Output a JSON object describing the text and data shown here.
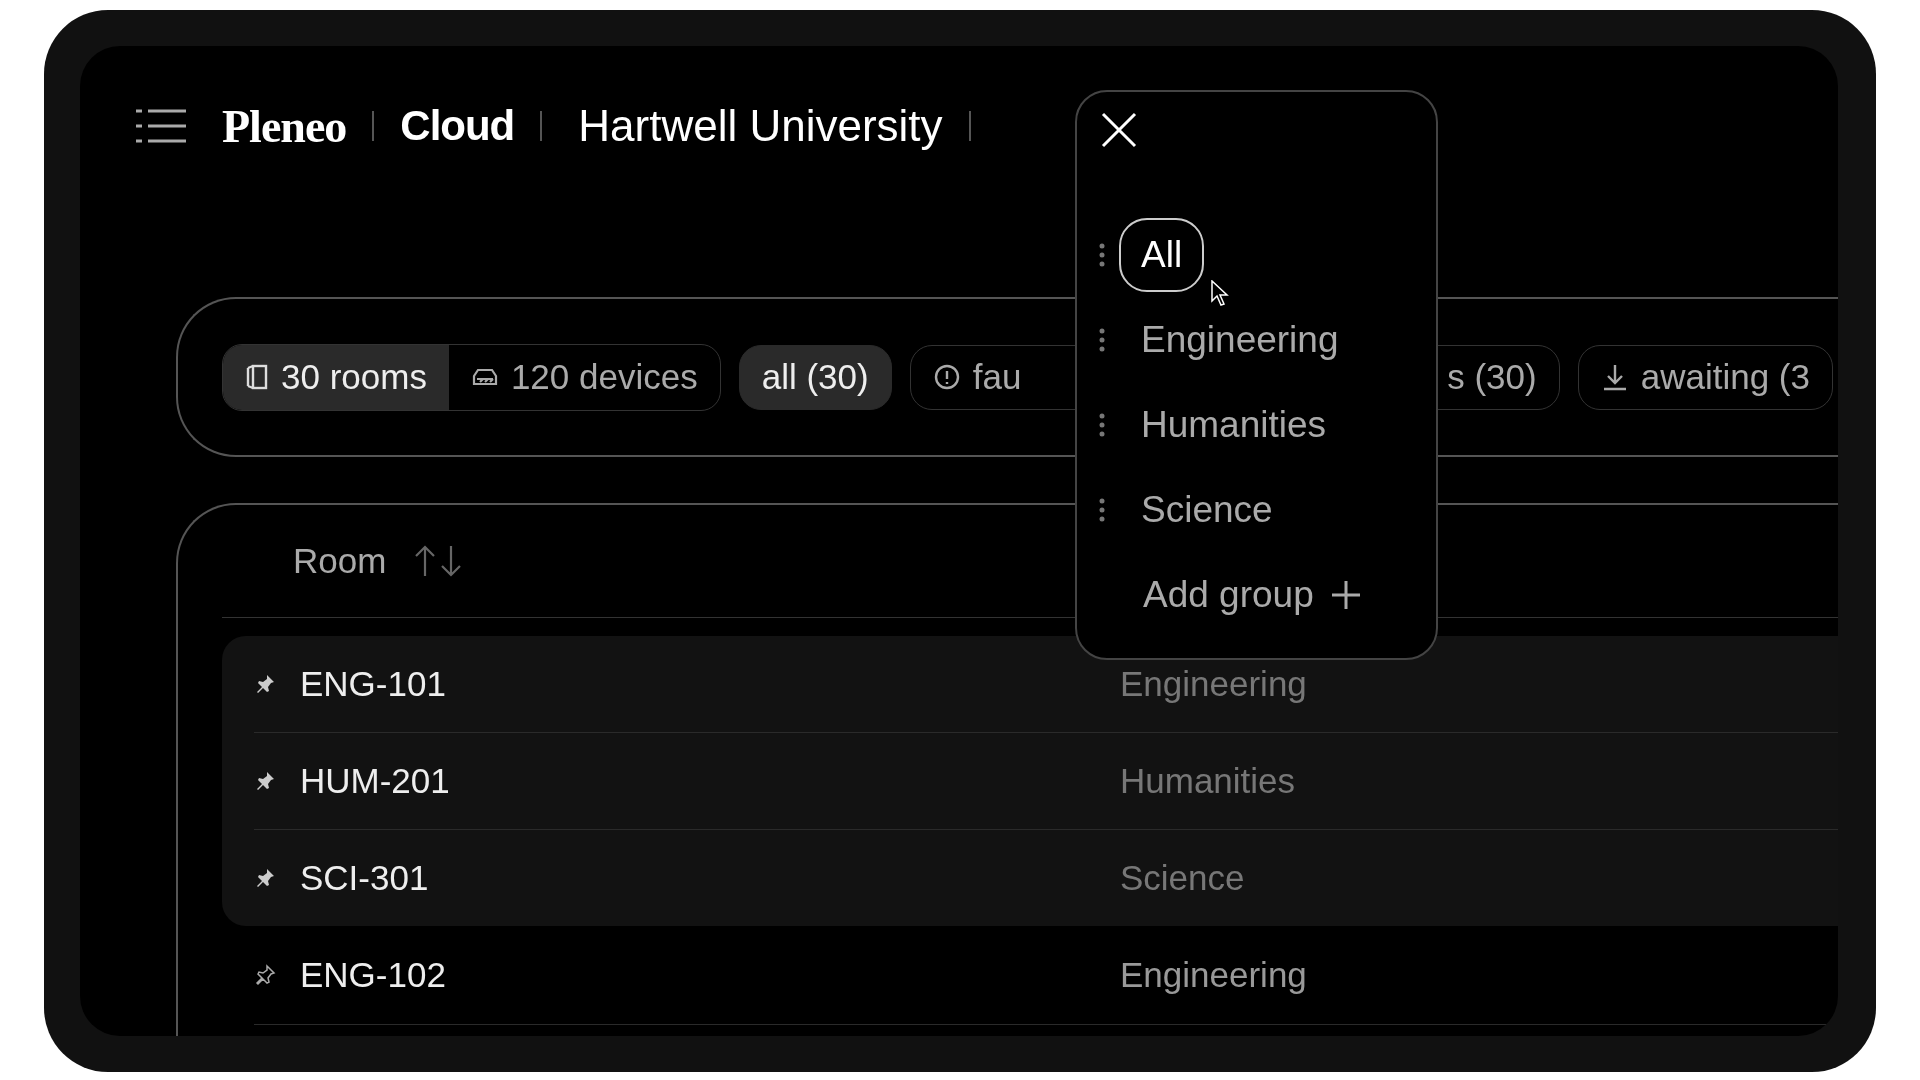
{
  "header": {
    "brand": "Pleneo",
    "product": "Cloud",
    "organization": "Hartwell University"
  },
  "summary": [
    {
      "label": "30 rooms",
      "kind": "rooms",
      "selected": true
    },
    {
      "label": "120 devices",
      "kind": "devices",
      "selected": false
    }
  ],
  "filters": [
    {
      "label": "all (30)",
      "kind": "plain",
      "selected": true
    },
    {
      "label": "fau",
      "kind": "fault",
      "selected": false
    },
    {
      "label": "s (30)",
      "kind": "plain",
      "selected": false
    },
    {
      "label": "awaiting (3",
      "kind": "download",
      "selected": false
    }
  ],
  "group_menu": {
    "items": [
      {
        "label": "All",
        "selected": true
      },
      {
        "label": "Engineering",
        "selected": false
      },
      {
        "label": "Humanities",
        "selected": false
      },
      {
        "label": "Science",
        "selected": false
      }
    ],
    "add_label": "Add group"
  },
  "table": {
    "columns": [
      "Room"
    ],
    "rows": [
      {
        "room": "ENG-101",
        "group": "Engineering",
        "pinned": true
      },
      {
        "room": "HUM-201",
        "group": "Humanities",
        "pinned": true
      },
      {
        "room": "SCI-301",
        "group": "Science",
        "pinned": true
      },
      {
        "room": "ENG-102",
        "group": "Engineering",
        "pinned": false
      }
    ]
  }
}
